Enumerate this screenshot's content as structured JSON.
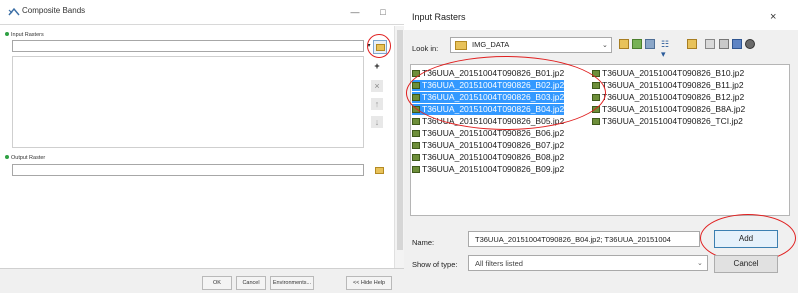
{
  "left_window": {
    "title": "Composite Bands",
    "minimize": "—",
    "maximize": "□",
    "input_rasters_label": "Input Rasters",
    "output_raster_label": "Output Raster",
    "add_symbol": "+",
    "remove_symbol": "×",
    "up_symbol": "↑",
    "down_symbol": "↓",
    "dropdown_symbol": "▾",
    "footer": {
      "ok": "OK",
      "cancel": "Cancel",
      "environments": "Environments...",
      "hide_help": "<< Hide Help"
    }
  },
  "dialog": {
    "title": "Input Rasters",
    "close": "×",
    "look_in_label": "Look in:",
    "look_in_value": "IMG_DATA",
    "dropdown_symbol": "⌄",
    "views_symbol": "☷ ▾",
    "files_col1": [
      "T36UUA_20151004T090826_B01.jp2",
      "T36UUA_20151004T090826_B02.jp2",
      "T36UUA_20151004T090826_B03.jp2",
      "T36UUA_20151004T090826_B04.jp2",
      "T36UUA_20151004T090826_B05.jp2",
      "T36UUA_20151004T090826_B06.jp2",
      "T36UUA_20151004T090826_B07.jp2",
      "T36UUA_20151004T090826_B08.jp2",
      "T36UUA_20151004T090826_B09.jp2"
    ],
    "files_col2": [
      "T36UUA_20151004T090826_B10.jp2",
      "T36UUA_20151004T090826_B11.jp2",
      "T36UUA_20151004T090826_B12.jp2",
      "T36UUA_20151004T090826_B8A.jp2",
      "T36UUA_20151004T090826_TCI.jp2"
    ],
    "selected_files": [
      "B02",
      "B03",
      "B04"
    ],
    "name_label": "Name:",
    "name_value": "T36UUA_20151004T090826_B04.jp2; T36UUA_20151004",
    "show_type_label": "Show of type:",
    "show_type_value": "All filters listed",
    "add": "Add",
    "cancel": "Cancel"
  },
  "colors": {
    "selection": "#3399ff",
    "annotation_ring": "#e02020"
  }
}
